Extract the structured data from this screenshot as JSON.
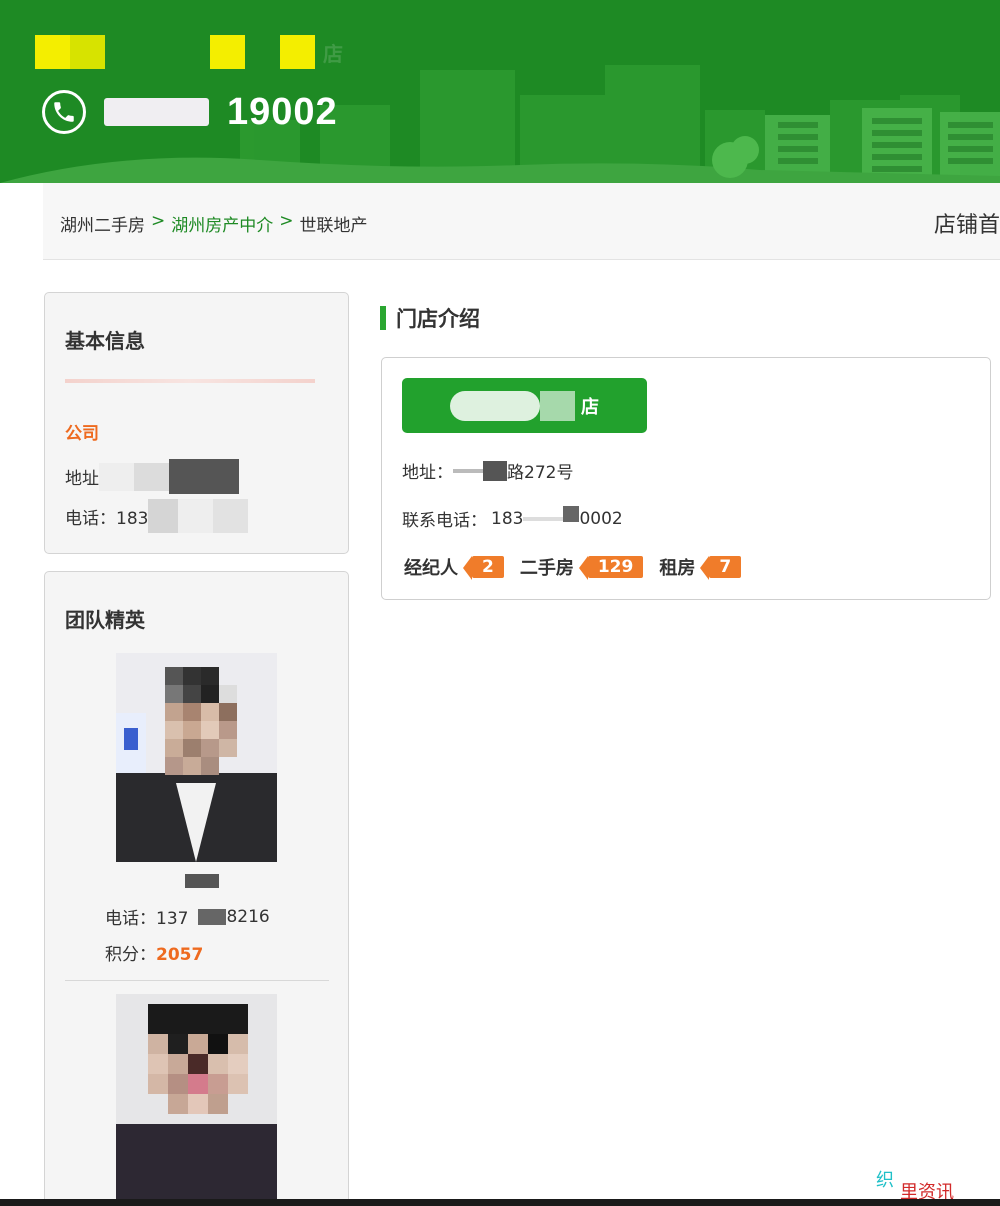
{
  "header": {
    "shop_title": "店",
    "phone_partial": "19002"
  },
  "breadcrumb": {
    "items": [
      {
        "label": "湖州二手房"
      },
      {
        "label": "湖州房产中介"
      },
      {
        "label": "世联地产"
      }
    ],
    "separator": ">",
    "store_home": "店铺首"
  },
  "basic_info": {
    "title": "基本信息",
    "company_label": "公司",
    "address_label": "地址",
    "phone_label": "电话：183"
  },
  "team": {
    "title": "团队精英",
    "agents": [
      {
        "phone": "电话：137",
        "phone_tail": "8216",
        "score_label": "积分：",
        "score": "2057"
      }
    ]
  },
  "store_intro": {
    "section_title": "门店介绍",
    "store_name_partial": "店",
    "address_label": "地址：",
    "address_tail": "路272号",
    "contact_label": "联系电话：",
    "contact_head": "183",
    "contact_tail": "0002",
    "stats": [
      {
        "label": "经纪人",
        "count": "2"
      },
      {
        "label": "二手房",
        "count": "129"
      },
      {
        "label": "租房",
        "count": "7"
      }
    ]
  },
  "watermark": {
    "a": "织",
    "b": "里资讯"
  },
  "colors": {
    "brand_green": "#1e8a24",
    "accent_orange": "#ee6a1f",
    "tag_orange": "#f07c2a"
  }
}
